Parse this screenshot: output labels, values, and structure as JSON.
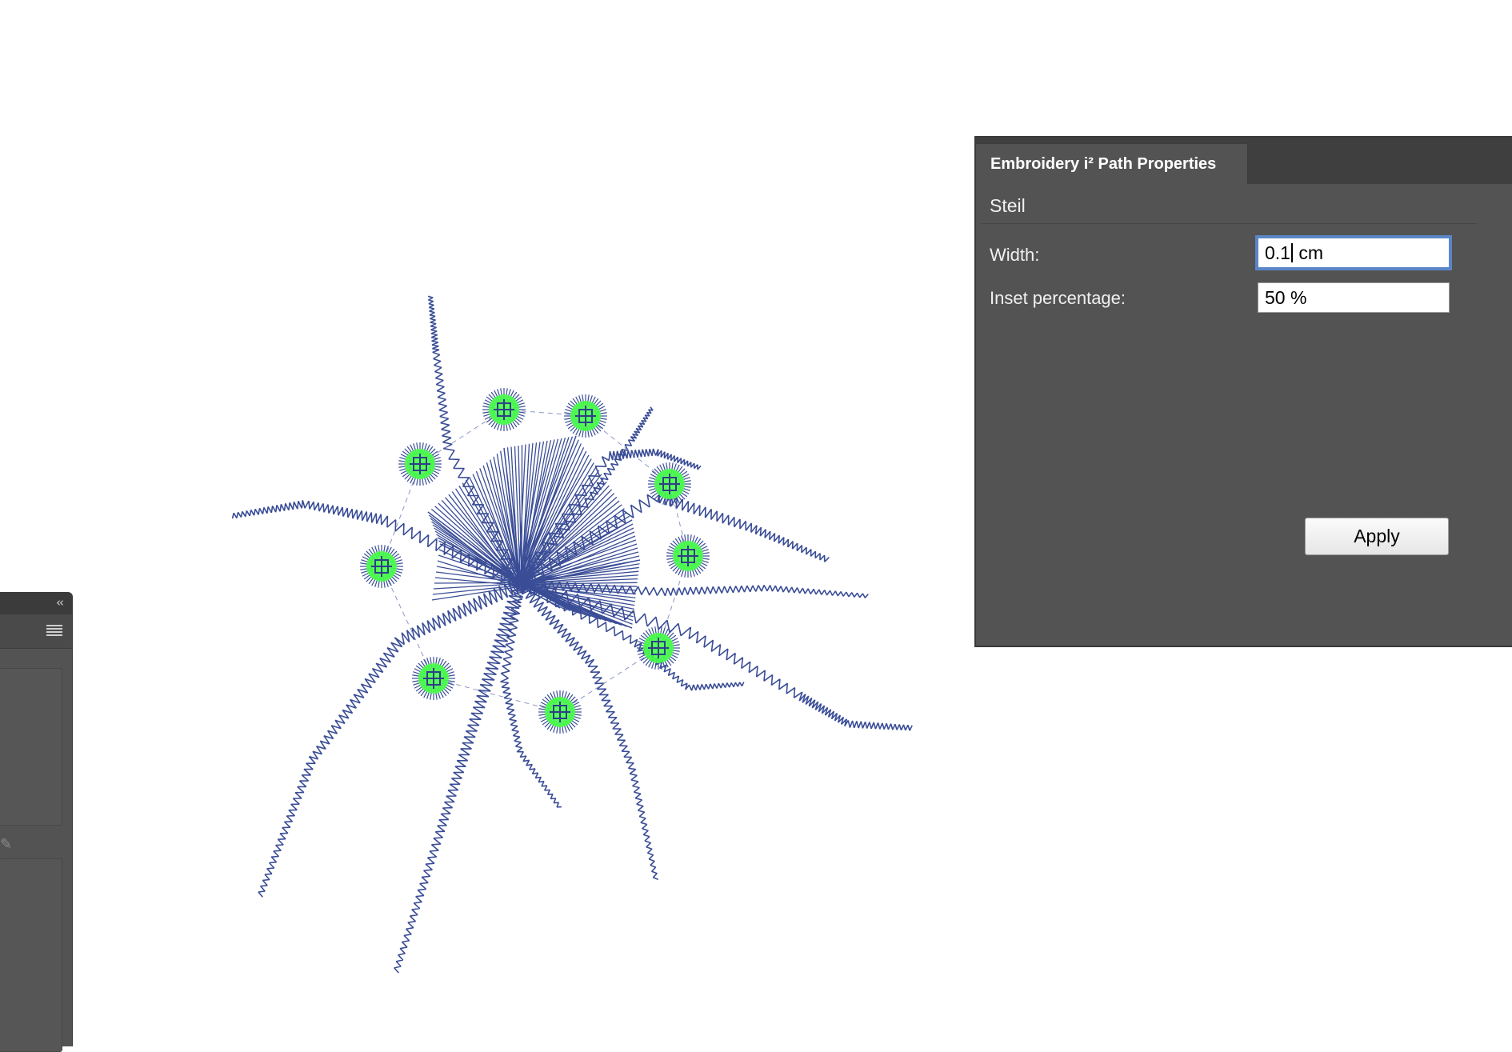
{
  "panel": {
    "tab_title": "Embroidery i² Path Properties",
    "section": "Steil",
    "width_label": "Width:",
    "width_value_before_caret": "0.1",
    "width_value_after_caret": " cm",
    "inset_label": "Inset percentage:",
    "inset_value": "50 %",
    "apply_label": "Apply"
  },
  "left_panel": {
    "collapse_icon": "double-chevron-left",
    "menu_icon": "hamburger-menu",
    "tool_icon": "pencil"
  },
  "colors": {
    "stitch": "#3a4d96",
    "handle_fill": "#45ff45",
    "panel_bg": "#535353"
  },
  "canvas": {
    "selected_handles": 9
  }
}
